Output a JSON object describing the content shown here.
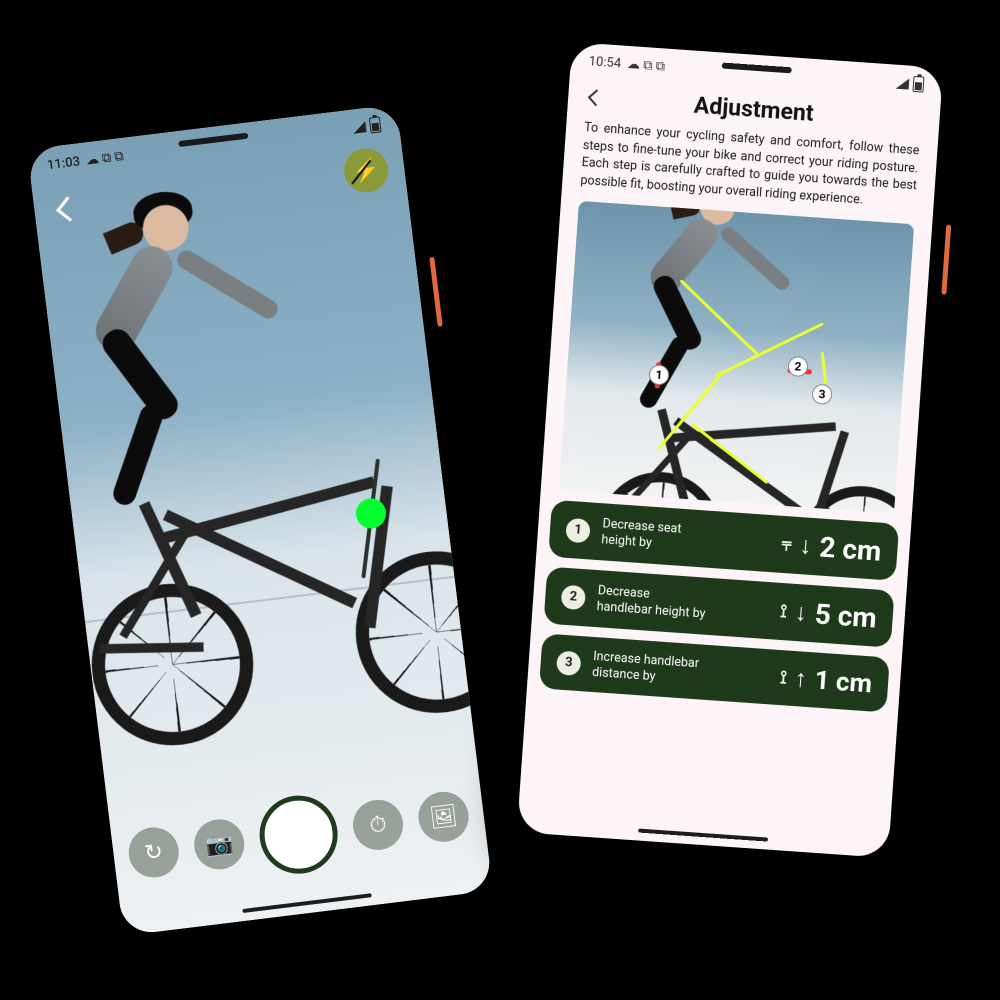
{
  "left": {
    "status": {
      "time": "11:03",
      "icons": "☁ ⧉ ⧉"
    },
    "buttons": {
      "switch": "↻",
      "shoot": "📷",
      "timer": "⏱",
      "gallery": "🖼"
    }
  },
  "right": {
    "status": {
      "time": "10:54",
      "icons": "☁ ⧉ ⧉"
    },
    "title": "Adjustment",
    "description": "To enhance your cycling safety and comfort, follow these steps to fine-tune your bike and correct your riding posture. Each step is carefully crafted to guide you towards the best possible fit, boosting your overall riding experience.",
    "markers": {
      "m1": "1",
      "m2": "2",
      "m3": "3"
    },
    "cards": [
      {
        "n": "1",
        "label": "Decrease seat height by",
        "icon": "⫧",
        "dir": "↓",
        "value": "2 cm"
      },
      {
        "n": "2",
        "label": "Decrease handlebar height by",
        "icon": "⟟",
        "dir": "↓",
        "value": "5 cm"
      },
      {
        "n": "3",
        "label": "Increase handlebar distance by",
        "icon": "⟟",
        "dir": "↑",
        "value": "1 cm"
      }
    ]
  }
}
